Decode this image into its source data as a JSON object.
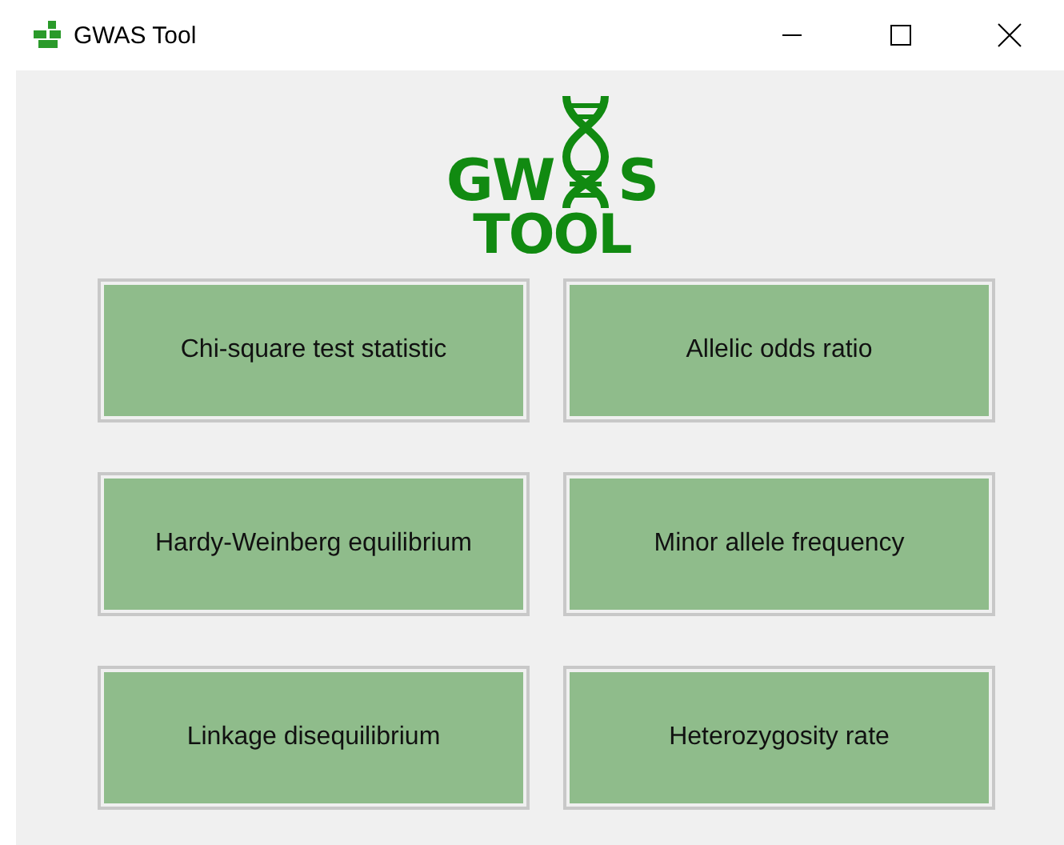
{
  "window": {
    "title": "GWAS Tool"
  },
  "logo": {
    "top_left": "GW",
    "top_right": "S",
    "bottom": "TOOL"
  },
  "buttons": [
    "Chi-square test statistic",
    "Allelic odds ratio",
    "Hardy-Weinberg equilibrium",
    "Minor allele frequency",
    "Linkage disequilibrium",
    "Heterozygosity rate"
  ]
}
